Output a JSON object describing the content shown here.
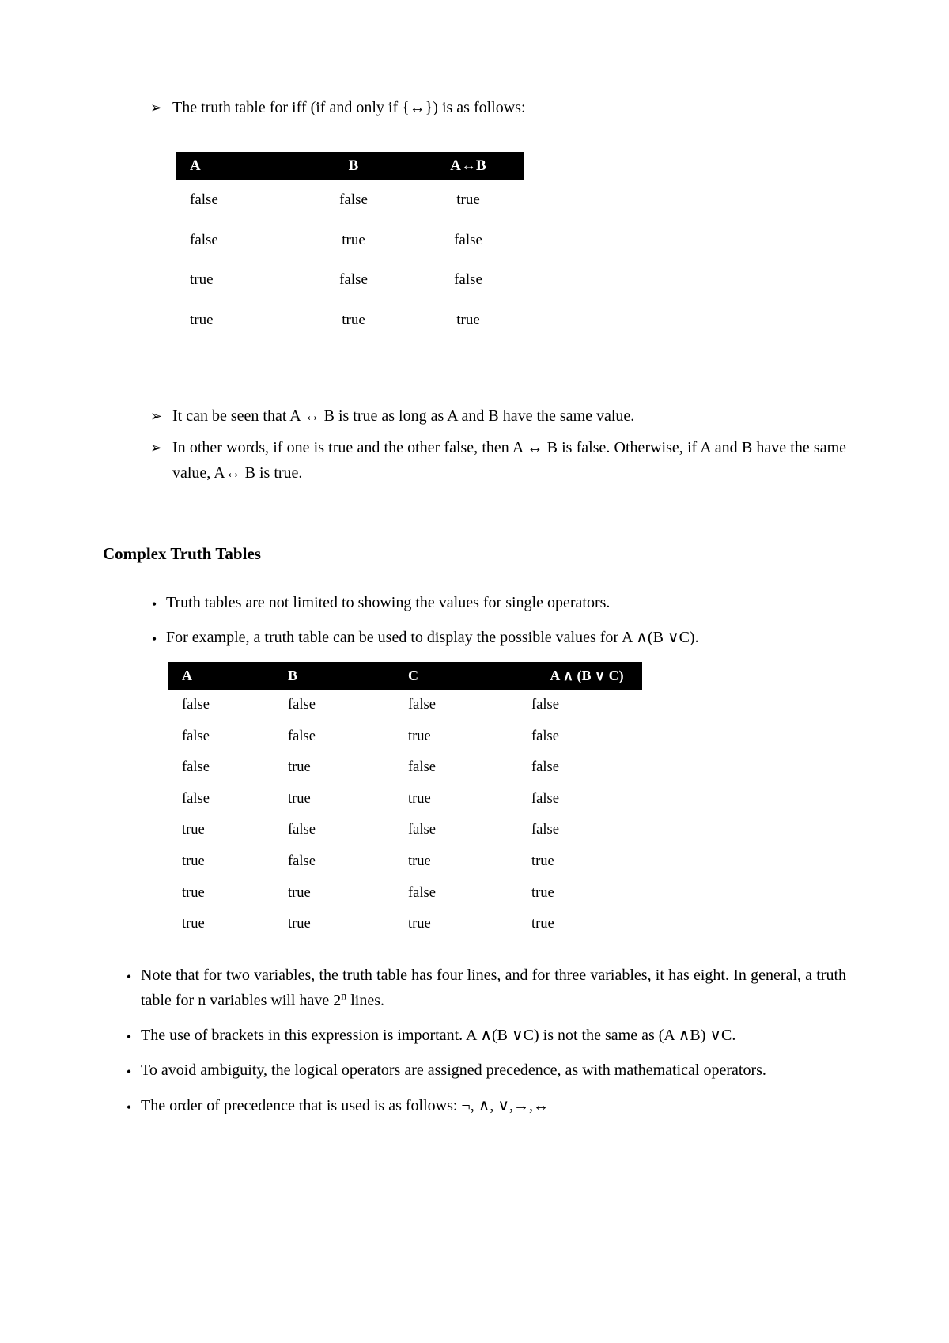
{
  "bullet_chars": {
    "arrow": "➢",
    "disc": "•"
  },
  "arrow1": {
    "text_html": "The truth table for iff (if and only if {↔}) is as follows:"
  },
  "iff_table": {
    "headers": [
      "A",
      "B",
      "A↔B"
    ],
    "rows": [
      [
        "false",
        "false",
        "true"
      ],
      [
        "false",
        "true",
        "false"
      ],
      [
        "true",
        "false",
        "false"
      ],
      [
        "true",
        "true",
        "true"
      ]
    ]
  },
  "arrow2": {
    "text_html": "It can be seen that A ↔ B is true as long as A and B have the same value."
  },
  "arrow3": {
    "text_html": "In other words, if one is true and the other false, then A ↔ B is false. Otherwise, if A and B have the same value, A↔ B is true."
  },
  "heading": "Complex Truth Tables",
  "disc_inner_1": {
    "text_html": "Truth tables are not limited to showing the values for single operators."
  },
  "disc_inner_2": {
    "text_html": "For example, a truth table can be used to display the possible values for A ∧(B ∨C)."
  },
  "complex_table": {
    "headers": [
      "A",
      "B",
      "C",
      "A ∧ (B ∨ C)"
    ],
    "rows": [
      [
        "false",
        "false",
        "false",
        "false"
      ],
      [
        "false",
        "false",
        "true",
        "false"
      ],
      [
        "false",
        "true",
        "false",
        "false"
      ],
      [
        "false",
        "true",
        "true",
        "false"
      ],
      [
        "true",
        "false",
        "false",
        "false"
      ],
      [
        "true",
        "false",
        "true",
        "true"
      ],
      [
        "true",
        "true",
        "false",
        "true"
      ],
      [
        "true",
        "true",
        "true",
        "true"
      ]
    ]
  },
  "disc_outer_1": {
    "text_html": "Note that for two variables, the truth table has four lines, and for three variables, it has eight. In general, a truth table for n variables will have 2<sup>n</sup> lines."
  },
  "disc_outer_2": {
    "text_html": "The use of brackets in this expression is important. A ∧(B ∨C) is not the same as (A ∧B) ∨C."
  },
  "disc_outer_3": {
    "text_html": "To avoid ambiguity, the logical operators are assigned precedence, as with mathematical operators."
  },
  "disc_outer_4": {
    "text_html": "The order of precedence that is used is as follows:  ¬, ∧, ∨,→,↔"
  }
}
